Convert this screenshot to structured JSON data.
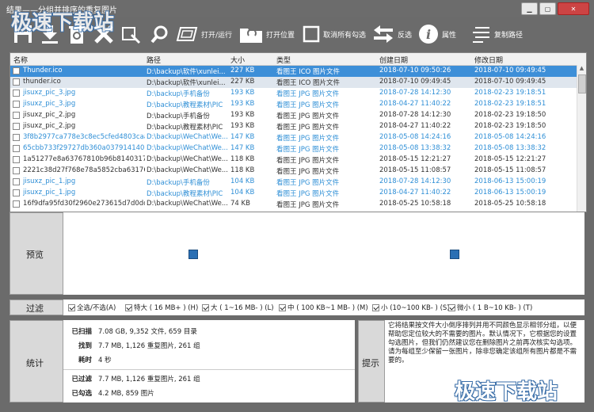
{
  "window": {
    "title": "结果——分组并排序的重复图片"
  },
  "watermark": "极速下载站",
  "toolbar": {
    "open_run": "打开/运行",
    "open_location": "打开位置",
    "uncheck_all": "取消所有勾选",
    "invert": "反选",
    "properties": "属性",
    "copy_path": "复制路径"
  },
  "grid": {
    "columns": [
      "名称",
      "路径",
      "大小",
      "类型",
      "创建日期",
      "修改日期"
    ],
    "rows": [
      {
        "name": "Thunder.ico",
        "path": "D:\\backup\\软件\\xunlei...",
        "size": "227 KB",
        "type": "看图王 ICO 图片文件",
        "created": "2018-07-10 09:50:26",
        "modified": "2018-07-10 09:49:45",
        "style": "sel"
      },
      {
        "name": "thunder.ico",
        "path": "D:\\backup\\软件\\xunlei...",
        "size": "227 KB",
        "type": "看图王 ICO 图片文件",
        "created": "2018-07-10 09:49:45",
        "modified": "2018-07-10 09:49:45",
        "style": "sel2"
      },
      {
        "name": "jisuxz_pic_3.jpg",
        "path": "D:\\backup\\手机备份",
        "size": "193 KB",
        "type": "看图王 JPG 图片文件",
        "created": "2018-07-28 14:12:30",
        "modified": "2018-02-23 19:18:51",
        "style": "blue"
      },
      {
        "name": "jisuxz_pic_3.jpg",
        "path": "D:\\backup\\教程素材\\PIC",
        "size": "193 KB",
        "type": "看图王 JPG 图片文件",
        "created": "2018-04-27 11:40:22",
        "modified": "2018-02-23 19:18:51",
        "style": "blue"
      },
      {
        "name": "jisuxz_pic_2.jpg",
        "path": "D:\\backup\\手机备份",
        "size": "193 KB",
        "type": "看图王 JPG 图片文件",
        "created": "2018-07-28 14:12:30",
        "modified": "2018-02-23 19:18:50",
        "style": "dark"
      },
      {
        "name": "jisuxz_pic_2.jpg",
        "path": "D:\\backup\\教程素材\\PIC",
        "size": "193 KB",
        "type": "看图王 JPG 图片文件",
        "created": "2018-04-27 11:40:22",
        "modified": "2018-02-23 19:18:50",
        "style": "dark"
      },
      {
        "name": "3f8b2977ca778e3c8ec5cfed4803caa_...",
        "path": "D:\\backup\\WeChat\\We...",
        "size": "147 KB",
        "type": "看图王 JPG 图片文件",
        "created": "2018-05-08 14:24:16",
        "modified": "2018-05-08 14:24:16",
        "style": "blue"
      },
      {
        "name": "65cbb733f29727db360a037914140b1f...",
        "path": "D:\\backup\\WeChat\\We...",
        "size": "147 KB",
        "type": "看图王 JPG 图片文件",
        "created": "2018-05-08 13:38:32",
        "modified": "2018-05-08 13:38:32",
        "style": "blue"
      },
      {
        "name": "1a51277e8a63767810b96b8140317284...",
        "path": "D:\\backup\\WeChat\\We...",
        "size": "118 KB",
        "type": "看图王 JPG 图片文件",
        "created": "2018-05-15 12:21:27",
        "modified": "2018-05-15 12:21:27",
        "style": "dark"
      },
      {
        "name": "2221c38d27f768e78a5852cba631766a...",
        "path": "D:\\backup\\WeChat\\We...",
        "size": "118 KB",
        "type": "看图王 JPG 图片文件",
        "created": "2018-05-15 11:08:57",
        "modified": "2018-05-15 11:08:57",
        "style": "dark"
      },
      {
        "name": "jisuxz_pic_1.jpg",
        "path": "D:\\backup\\手机备份",
        "size": "104 KB",
        "type": "看图王 JPG 图片文件",
        "created": "2018-07-28 14:12:30",
        "modified": "2018-06-13 15:00:19",
        "style": "blue"
      },
      {
        "name": "jisuxz_pic_1.jpg",
        "path": "D:\\backup\\教程素材\\PIC",
        "size": "104 KB",
        "type": "看图王 JPG 图片文件",
        "created": "2018-04-27 11:40:22",
        "modified": "2018-06-13 15:00:19",
        "style": "blue"
      },
      {
        "name": "16f9dfa95fd30f2960e273615d7d0dc8_...",
        "path": "D:\\backup\\WeChat\\We...",
        "size": "74 KB",
        "type": "看图王 JPG 图片文件",
        "created": "2018-05-25 10:58:18",
        "modified": "2018-05-25 10:58:18",
        "style": "dark"
      }
    ]
  },
  "preview": {
    "label": "预览"
  },
  "filter": {
    "label": "过滤",
    "options": [
      "全选/不选(A)",
      "特大 ( 16 MB+ ) (H)",
      "大 ( 1~16 MB- ) (L)",
      "中 ( 100 KB~1 MB- ) (M)",
      "小 (10~100 KB- ) (S)",
      "微小 ( 1 B~10 KB- ) (T)"
    ]
  },
  "stats": {
    "label": "统计",
    "scanned_k": "已扫描",
    "scanned_v": "7.08 GB, 9,352 文件, 659 目录",
    "found_k": "找到",
    "found_v": "7.7 MB, 1,126 重复图片, 261 组",
    "time_k": "耗时",
    "time_v": "4 秒",
    "filtered_k": "已过滤",
    "filtered_v": "7.7 MB, 1,126 重复图片, 261 组",
    "checked_k": "已勾选",
    "checked_v": "4.2 MB, 859 图片"
  },
  "tip": {
    "label": "提示",
    "text": "它将结果按文件大小倒序排列并用不同颜色显示相邻分组，以便帮助您定位较大的不需要的图片。默认情况下，它根据您的设置勾选图片，但我们仍然建议您在删除图片之前再次核实勾选项。请为每组至少保留一张图片，除非您确定该组所有图片都是不需要的。"
  },
  "colors": {
    "selected": "#3d8fd8",
    "blue_text": "#2f8fd6",
    "dark_text": "#333333",
    "panel": "#d9d9d9"
  }
}
